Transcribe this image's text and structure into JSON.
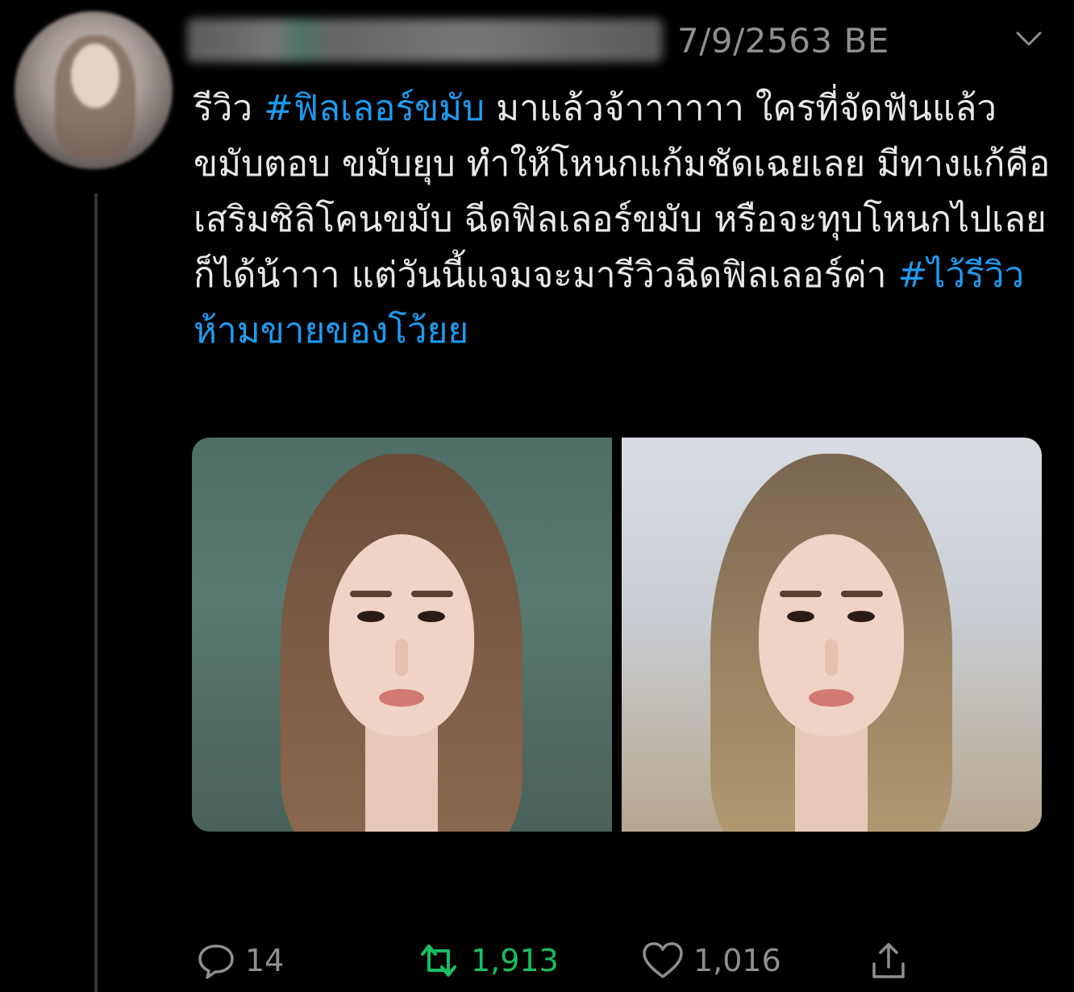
{
  "tweet": {
    "timestamp": "7/9/2563 BE",
    "body_prefix": "รีวิว ",
    "hashtag_1": "#ฟิลเลอร์ขมับ",
    "body_main": " มาแล้วจ้าาาาาา ใครที่จัดฟันแล้วขมับตอบ ขมับยุบ ทำให้โหนกแก้มชัดเฉยเลย มีทางแก้คือเสริมซิลิโคนขมับ ฉีดฟิลเลอร์ขมับ หรือจะทุบโหนกไปเลยก็ได้น้าาา แต่วันนี้แจมจะมารีวิวฉีดฟิลเลอร์ค่า ",
    "hashtag_2": "#ไว้รีวิวห้ามขายของโว้ยย"
  },
  "actions": {
    "reply_count": "14",
    "retweet_count": "1,913",
    "like_count": "1,016"
  },
  "icons": {
    "menu": "chevron-down-icon",
    "reply": "reply-icon",
    "retweet": "retweet-icon",
    "like": "heart-icon",
    "share": "share-icon"
  },
  "colors": {
    "background": "#000000",
    "text": "#e8e8e8",
    "muted": "#8f8f8f",
    "hashtag": "#1d9bf0",
    "retweet_active": "#17bf63"
  }
}
